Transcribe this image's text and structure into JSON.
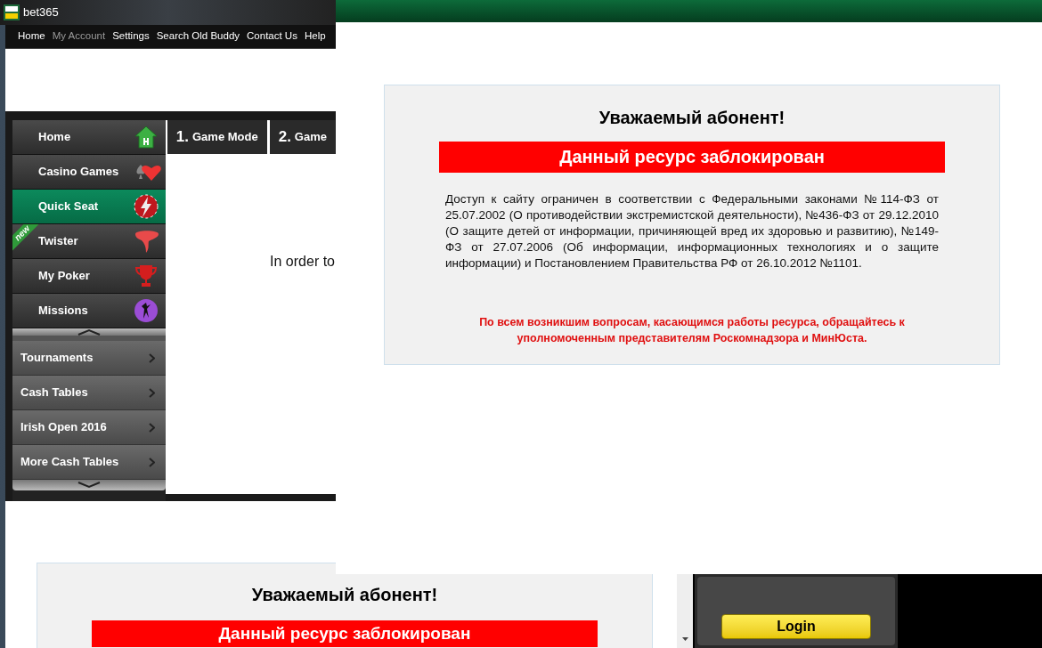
{
  "back_window": {
    "title": "bet365",
    "nav": [
      {
        "label": "Home",
        "disabled": false
      },
      {
        "label": "My Account",
        "disabled": true
      },
      {
        "label": "Settings",
        "disabled": false
      },
      {
        "label": "Search Old Buddy",
        "disabled": false
      },
      {
        "label": "Contact Us",
        "disabled": false
      },
      {
        "label": "Help",
        "disabled": false
      }
    ],
    "sidebar": {
      "items": [
        {
          "label": "Home",
          "selected": false
        },
        {
          "label": "Casino Games",
          "selected": false
        },
        {
          "label": "Quick Seat",
          "selected": true
        },
        {
          "label": "Twister",
          "selected": false,
          "badge": "new"
        },
        {
          "label": "My Poker",
          "selected": false
        },
        {
          "label": "Missions",
          "selected": false
        }
      ],
      "lobby_items": [
        {
          "label": "Tournaments"
        },
        {
          "label": "Cash Tables"
        },
        {
          "label": "Irish Open 2016"
        },
        {
          "label": "More Cash Tables"
        }
      ]
    },
    "tabs": [
      {
        "number": "1.",
        "label": "Game Mode"
      },
      {
        "number": "2.",
        "label": "Game"
      }
    ],
    "body_text": "In order to"
  },
  "notice": {
    "heading": "Уважаемый абонент!",
    "banner": "Данный ресурс заблокирован",
    "body": "Доступ к сайту ограничен в соответствии с Федеральными законами №114-ФЗ от 25.07.2002 (О противодействии экстремистской деятельности), №436-ФЗ от 29.12.2010 (О защите детей от информации, причиняющей вред их здоровью и развитию), №149-ФЗ от 27.07.2006 (Об информации, информационных технологиях и о защите информации) и Постановлением Правительства РФ от 26.10.2012 №1101.",
    "contact": "По всем возникшим вопросам, касающимся работы ресурса, обращайтесь к уполномоченным представителям Роскомнадзора и МинЮста."
  },
  "lower_notice": {
    "heading": "Уважаемый абонент!",
    "banner": "Данный ресурс заблокирован"
  },
  "login_button": "Login"
}
